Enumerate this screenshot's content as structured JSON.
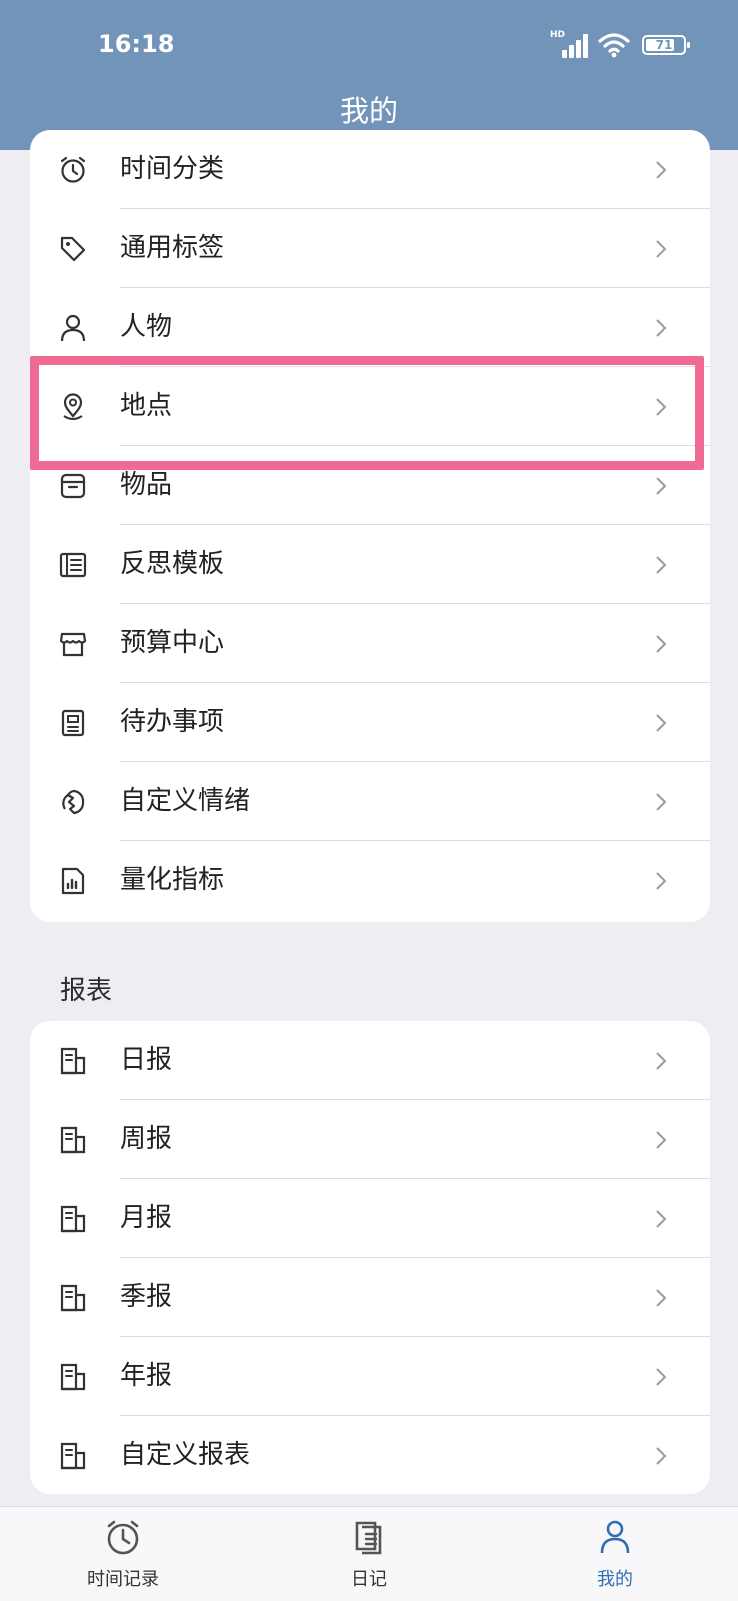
{
  "status_bar": {
    "time": "16:18",
    "network": "HD",
    "battery": "71"
  },
  "header": {
    "title": "我的"
  },
  "settings_list": [
    {
      "label": "时间分类",
      "icon": "alarm-clock-icon"
    },
    {
      "label": "通用标签",
      "icon": "tag-icon"
    },
    {
      "label": "人物",
      "icon": "person-icon"
    },
    {
      "label": "地点",
      "icon": "location-pin-icon"
    },
    {
      "label": "物品",
      "icon": "box-icon"
    },
    {
      "label": "反思模板",
      "icon": "template-icon"
    },
    {
      "label": "预算中心",
      "icon": "store-icon"
    },
    {
      "label": "待办事项",
      "icon": "checklist-icon"
    },
    {
      "label": "自定义情绪",
      "icon": "mood-icon"
    },
    {
      "label": "量化指标",
      "icon": "chart-file-icon"
    }
  ],
  "reports_section": {
    "title": "报表",
    "items": [
      {
        "label": "日报",
        "icon": "report-icon"
      },
      {
        "label": "周报",
        "icon": "report-icon"
      },
      {
        "label": "月报",
        "icon": "report-icon"
      },
      {
        "label": "季报",
        "icon": "report-icon"
      },
      {
        "label": "年报",
        "icon": "report-icon"
      },
      {
        "label": "自定义报表",
        "icon": "report-icon"
      }
    ]
  },
  "tabbar": {
    "tabs": [
      {
        "label": "时间记录",
        "icon": "alarm-clock-icon"
      },
      {
        "label": "日记",
        "icon": "diary-icon"
      },
      {
        "label": "我的",
        "icon": "profile-icon",
        "active": true
      }
    ]
  },
  "colors": {
    "header": "#7194b8",
    "highlight": "#f06b93",
    "active_tab": "#2f6fb0",
    "background": "#ededf2"
  }
}
